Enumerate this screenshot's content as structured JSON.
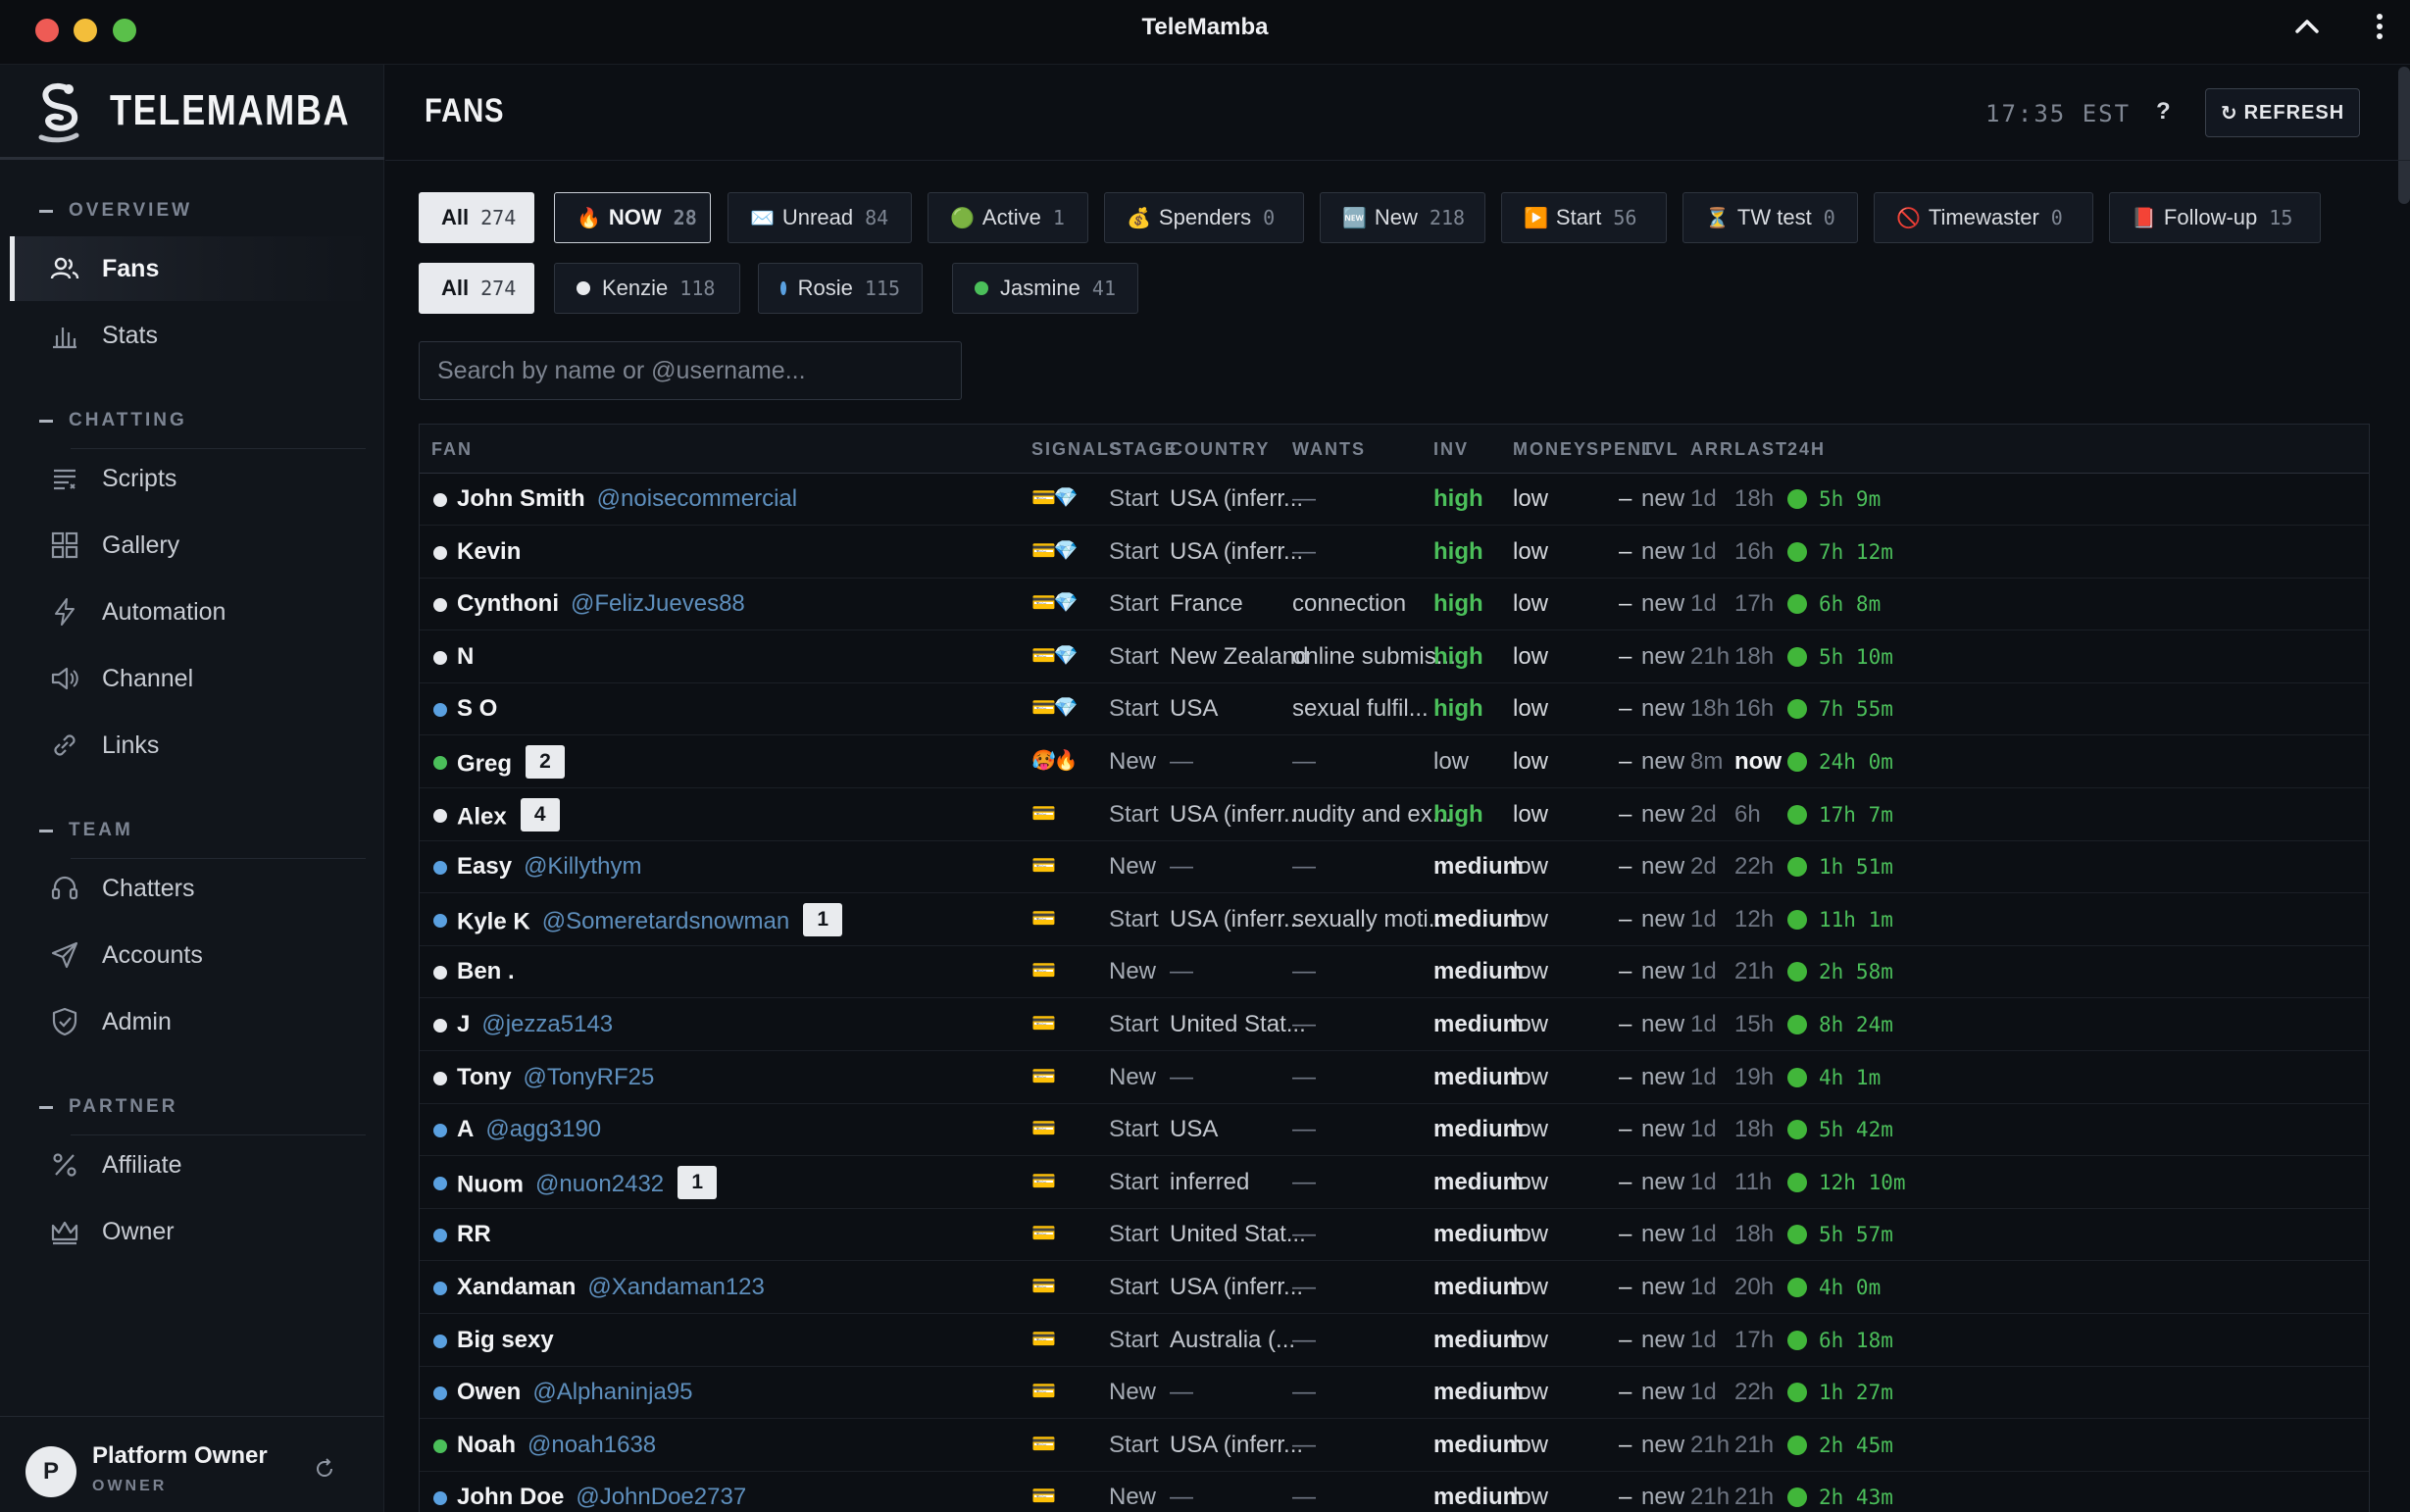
{
  "window": {
    "title": "TeleMamba"
  },
  "brand": {
    "name": "TELEMAMBA"
  },
  "sidebar": {
    "sections": [
      {
        "title": "OVERVIEW",
        "items": [
          {
            "label": "Fans",
            "icon": "users-icon",
            "active": true
          },
          {
            "label": "Stats",
            "icon": "bar-chart-icon"
          }
        ]
      },
      {
        "title": "CHATTING",
        "items": [
          {
            "label": "Scripts",
            "icon": "list-icon"
          },
          {
            "label": "Gallery",
            "icon": "grid-icon"
          },
          {
            "label": "Automation",
            "icon": "bolt-icon"
          },
          {
            "label": "Channel",
            "icon": "megaphone-icon"
          },
          {
            "label": "Links",
            "icon": "link-icon"
          }
        ]
      },
      {
        "title": "TEAM",
        "items": [
          {
            "label": "Chatters",
            "icon": "headset-icon"
          },
          {
            "label": "Accounts",
            "icon": "send-icon"
          },
          {
            "label": "Admin",
            "icon": "shield-icon"
          }
        ]
      },
      {
        "title": "PARTNER",
        "items": [
          {
            "label": "Affiliate",
            "icon": "percent-icon"
          },
          {
            "label": "Owner",
            "icon": "crown-icon"
          }
        ]
      }
    ],
    "user": {
      "initial": "P",
      "name": "Platform Owner",
      "role": "OWNER"
    }
  },
  "header": {
    "title": "FANS",
    "clock": "17:35 EST",
    "help": "?",
    "refresh_icon": "↻",
    "refresh_label": "REFRESH"
  },
  "filters": [
    {
      "label": "All",
      "count": "274",
      "emoji": "",
      "selected": true
    },
    {
      "label": "NOW",
      "count": "28",
      "emoji": "🔥",
      "outlined": true
    },
    {
      "label": "Unread",
      "count": "84",
      "emoji": "✉️"
    },
    {
      "label": "Active",
      "count": "1",
      "emoji": "🟢"
    },
    {
      "label": "Spenders",
      "count": "0",
      "emoji": "💰"
    },
    {
      "label": "New",
      "count": "218",
      "emoji": "🆕"
    },
    {
      "label": "Start",
      "count": "56",
      "emoji": "▶️"
    },
    {
      "label": "TW test",
      "count": "0",
      "emoji": "⏳"
    },
    {
      "label": "Timewaster",
      "count": "0",
      "emoji": "🚫"
    },
    {
      "label": "Follow-up",
      "count": "15",
      "emoji": "📕"
    }
  ],
  "chatter_filters": [
    {
      "label": "All",
      "count": "274",
      "dot": "",
      "selected": true
    },
    {
      "label": "Kenzie",
      "count": "118",
      "dot": "#e8eaee"
    },
    {
      "label": "Rosie",
      "count": "115",
      "dot": "#5aa0e0"
    },
    {
      "label": "Jasmine",
      "count": "41",
      "dot": "#4bbf5a"
    }
  ],
  "search": {
    "placeholder": "Search by name or @username..."
  },
  "table": {
    "columns": [
      "FAN",
      "SIGNALS",
      "STAGE",
      "COUNTRY",
      "WANTS",
      "INV",
      "MONEY",
      "SPENT",
      "LVL",
      "ARR",
      "LAST",
      "24H"
    ],
    "rows": [
      {
        "dot": "#e8eaee",
        "name": "John Smith",
        "handle": "@noisecommercial",
        "badge": "",
        "signals": "💳💎",
        "stage": "Start",
        "country": "USA (inferr...",
        "wants": "—",
        "inv": "high",
        "money": "low",
        "spent": "–",
        "lvl": "new",
        "arr": "1d",
        "last": "18h",
        "h24": "5h 9m"
      },
      {
        "dot": "#e8eaee",
        "name": "Kevin",
        "handle": "",
        "badge": "",
        "signals": "💳💎",
        "stage": "Start",
        "country": "USA (inferr...",
        "wants": "—",
        "inv": "high",
        "money": "low",
        "spent": "–",
        "lvl": "new",
        "arr": "1d",
        "last": "16h",
        "h24": "7h 12m"
      },
      {
        "dot": "#e8eaee",
        "name": "Cynthoni",
        "handle": "@FelizJueves88",
        "badge": "",
        "signals": "💳💎",
        "stage": "Start",
        "country": "France",
        "wants": "connection",
        "inv": "high",
        "money": "low",
        "spent": "–",
        "lvl": "new",
        "arr": "1d",
        "last": "17h",
        "h24": "6h 8m"
      },
      {
        "dot": "#e8eaee",
        "name": "N",
        "handle": "",
        "badge": "",
        "signals": "💳💎",
        "stage": "Start",
        "country": "New Zealand",
        "wants": "online submis...",
        "inv": "high",
        "money": "low",
        "spent": "–",
        "lvl": "new",
        "arr": "21h",
        "last": "18h",
        "h24": "5h 10m"
      },
      {
        "dot": "#5aa0e0",
        "name": "S O",
        "handle": "",
        "badge": "",
        "signals": "💳💎",
        "stage": "Start",
        "country": "USA",
        "wants": "sexual fulfil...",
        "inv": "high",
        "money": "low",
        "spent": "–",
        "lvl": "new",
        "arr": "18h",
        "last": "16h",
        "h24": "7h 55m"
      },
      {
        "dot": "#4bbf5a",
        "name": "Greg",
        "handle": "",
        "badge": "2",
        "signals": "🥵🔥",
        "stage": "New",
        "country": "—",
        "wants": "—",
        "inv": "low",
        "money": "low",
        "spent": "–",
        "lvl": "new",
        "arr": "8m",
        "last": "now",
        "h24": "24h 0m"
      },
      {
        "dot": "#e8eaee",
        "name": "Alex",
        "handle": "",
        "badge": "4",
        "signals": "💳",
        "stage": "Start",
        "country": "USA (inferr...",
        "wants": "nudity and ex...",
        "inv": "high",
        "money": "low",
        "spent": "–",
        "lvl": "new",
        "arr": "2d",
        "last": "6h",
        "h24": "17h 7m"
      },
      {
        "dot": "#5aa0e0",
        "name": "Easy",
        "handle": "@Killythym",
        "badge": "",
        "signals": "💳",
        "stage": "New",
        "country": "—",
        "wants": "—",
        "inv": "medium",
        "money": "low",
        "spent": "–",
        "lvl": "new",
        "arr": "2d",
        "last": "22h",
        "h24": "1h 51m"
      },
      {
        "dot": "#5aa0e0",
        "name": "Kyle K",
        "handle": "@Someretardsnowman",
        "badge": "1",
        "signals": "💳",
        "stage": "Start",
        "country": "USA (inferr...",
        "wants": "sexually moti...",
        "inv": "medium",
        "money": "low",
        "spent": "–",
        "lvl": "new",
        "arr": "1d",
        "last": "12h",
        "h24": "11h 1m"
      },
      {
        "dot": "#e8eaee",
        "name": "Ben .",
        "handle": "",
        "badge": "",
        "signals": "💳",
        "stage": "New",
        "country": "—",
        "wants": "—",
        "inv": "medium",
        "money": "low",
        "spent": "–",
        "lvl": "new",
        "arr": "1d",
        "last": "21h",
        "h24": "2h 58m"
      },
      {
        "dot": "#e8eaee",
        "name": "J",
        "handle": "@jezza5143",
        "badge": "",
        "signals": "💳",
        "stage": "Start",
        "country": "United Stat...",
        "wants": "—",
        "inv": "medium",
        "money": "low",
        "spent": "–",
        "lvl": "new",
        "arr": "1d",
        "last": "15h",
        "h24": "8h 24m"
      },
      {
        "dot": "#e8eaee",
        "name": "Tony",
        "handle": "@TonyRF25",
        "badge": "",
        "signals": "💳",
        "stage": "New",
        "country": "—",
        "wants": "—",
        "inv": "medium",
        "money": "low",
        "spent": "–",
        "lvl": "new",
        "arr": "1d",
        "last": "19h",
        "h24": "4h 1m"
      },
      {
        "dot": "#5aa0e0",
        "name": "A",
        "handle": "@agg3190",
        "badge": "",
        "signals": "💳",
        "stage": "Start",
        "country": "USA",
        "wants": "—",
        "inv": "medium",
        "money": "low",
        "spent": "–",
        "lvl": "new",
        "arr": "1d",
        "last": "18h",
        "h24": "5h 42m"
      },
      {
        "dot": "#5aa0e0",
        "name": "Nuom",
        "handle": "@nuon2432",
        "badge": "1",
        "signals": "💳",
        "stage": "Start",
        "country": "inferred",
        "wants": "—",
        "inv": "medium",
        "money": "low",
        "spent": "–",
        "lvl": "new",
        "arr": "1d",
        "last": "11h",
        "h24": "12h 10m"
      },
      {
        "dot": "#5aa0e0",
        "name": "RR",
        "handle": "",
        "badge": "",
        "signals": "💳",
        "stage": "Start",
        "country": "United Stat...",
        "wants": "—",
        "inv": "medium",
        "money": "low",
        "spent": "–",
        "lvl": "new",
        "arr": "1d",
        "last": "18h",
        "h24": "5h 57m"
      },
      {
        "dot": "#5aa0e0",
        "name": "Xandaman",
        "handle": "@Xandaman123",
        "badge": "",
        "signals": "💳",
        "stage": "Start",
        "country": "USA (inferr...",
        "wants": "—",
        "inv": "medium",
        "money": "low",
        "spent": "–",
        "lvl": "new",
        "arr": "1d",
        "last": "20h",
        "h24": "4h 0m"
      },
      {
        "dot": "#5aa0e0",
        "name": "Big sexy",
        "handle": "",
        "badge": "",
        "signals": "💳",
        "stage": "Start",
        "country": "Australia (...",
        "wants": "—",
        "inv": "medium",
        "money": "low",
        "spent": "–",
        "lvl": "new",
        "arr": "1d",
        "last": "17h",
        "h24": "6h 18m"
      },
      {
        "dot": "#5aa0e0",
        "name": "Owen",
        "handle": "@Alphaninja95",
        "badge": "",
        "signals": "💳",
        "stage": "New",
        "country": "—",
        "wants": "—",
        "inv": "medium",
        "money": "low",
        "spent": "–",
        "lvl": "new",
        "arr": "1d",
        "last": "22h",
        "h24": "1h 27m"
      },
      {
        "dot": "#4bbf5a",
        "name": "Noah",
        "handle": "@noah1638",
        "badge": "",
        "signals": "💳",
        "stage": "Start",
        "country": "USA (inferr...",
        "wants": "—",
        "inv": "medium",
        "money": "low",
        "spent": "–",
        "lvl": "new",
        "arr": "21h",
        "last": "21h",
        "h24": "2h 45m"
      },
      {
        "dot": "#5aa0e0",
        "name": "John Doe",
        "handle": "@JohnDoe2737",
        "badge": "",
        "signals": "💳",
        "stage": "New",
        "country": "—",
        "wants": "—",
        "inv": "medium",
        "money": "low",
        "spent": "–",
        "lvl": "new",
        "arr": "21h",
        "last": "21h",
        "h24": "2h 43m"
      }
    ]
  }
}
